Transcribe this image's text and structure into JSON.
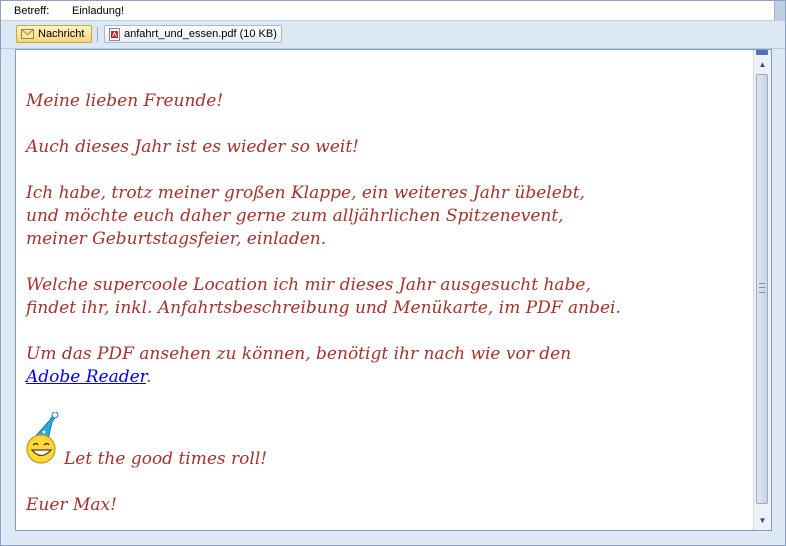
{
  "header": {
    "subject_label": "Betreff:",
    "subject_value": "Einladung!"
  },
  "attachments": {
    "message_tab_label": "Nachricht",
    "file_label": "anfahrt_und_essen.pdf (10 KB)"
  },
  "message": {
    "greeting": "Meine lieben Freunde!",
    "para1": "Auch dieses Jahr ist es wieder so weit!",
    "para2": "Ich habe, trotz meiner großen Klappe, ein weiteres Jahr übelebt,\nund möchte euch daher gerne zum alljährlichen Spitzenevent,\nmeiner Geburtstagsfeier, einladen.",
    "para3": "Welche supercoole Location ich mir dieses Jahr ausgesucht habe,\nfindet ihr, inkl. Anfahrtsbeschreibung und Menükarte, im PDF anbei.",
    "para4_text": "Um das PDF ansehen zu können, benötigt ihr nach wie vor den\n",
    "para4_link": "Adobe Reader",
    "para4_end": ".",
    "party_line": "Let the good times roll!",
    "signoff": "Euer Max!"
  },
  "icons": {
    "message_tab": "envelope-icon",
    "attachment": "pdf-icon",
    "emoticon": "party-smiley-icon"
  },
  "colors": {
    "body_text": "#a3332c",
    "link": "#0000ee"
  }
}
